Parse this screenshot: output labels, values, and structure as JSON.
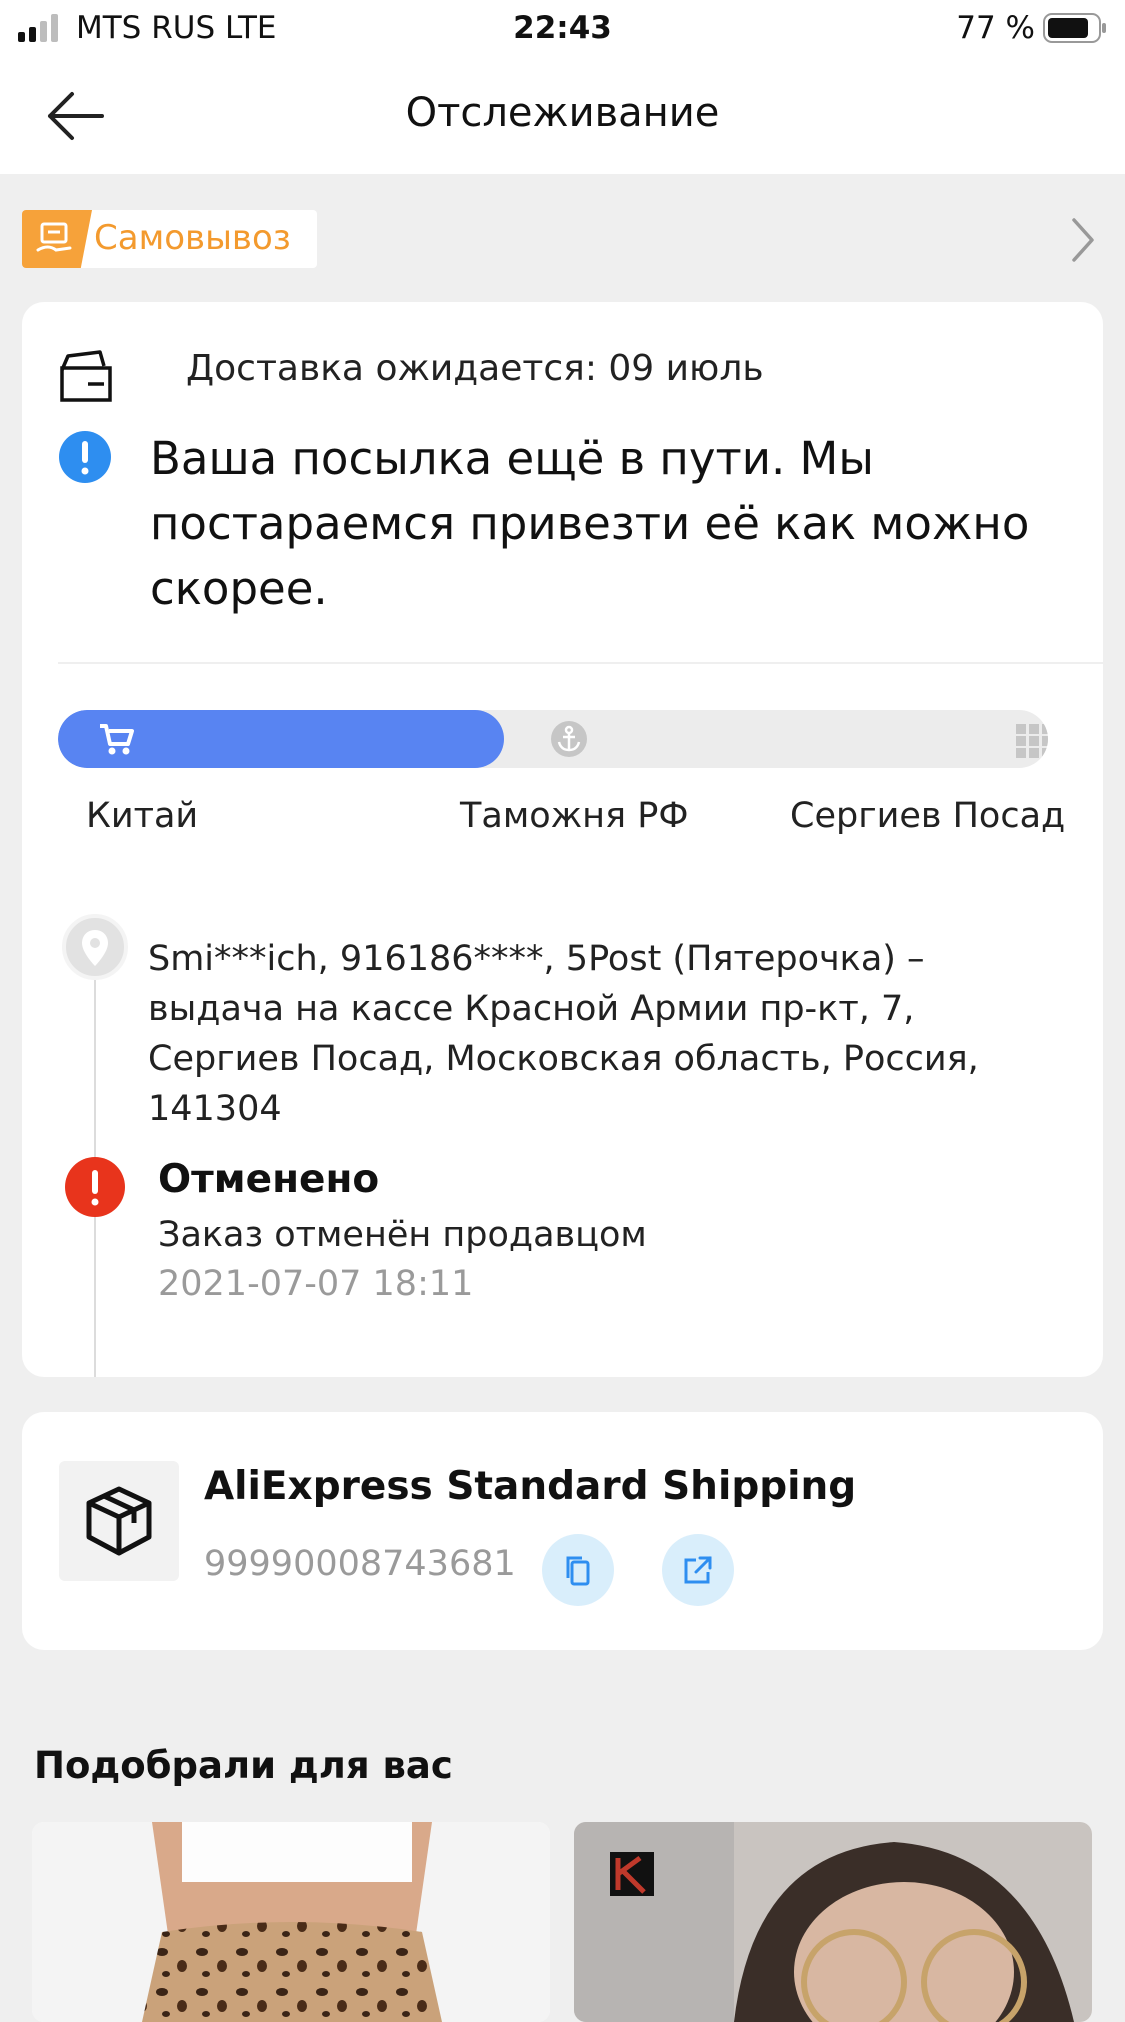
{
  "status_bar": {
    "carrier": "MTS RUS   LTE",
    "time": "22:43",
    "battery": "77 %"
  },
  "header": {
    "title": "Отслеживание"
  },
  "pickup": {
    "label": "Самовывоз",
    "accent_color": "#f39a2e"
  },
  "tracking": {
    "delivery_expected": "Доставка ожидается: 09 июль",
    "status_message": "Ваша посылка ещё в пути. Мы постараемся привезти её как можно скорее.",
    "progress": {
      "fill_fraction": 0.45,
      "color": "#5884f2",
      "stages": [
        "Китай",
        "Таможня РФ",
        "Сергиев Посад"
      ]
    },
    "address": "Smi***ich,  916186****,  5Post (Пятерочка) – выдача на кассе Красной Армии пр-кт, 7,  Сергиев Посад,  Московская область,  Россия,  141304",
    "event": {
      "title": "Отменено",
      "description": "Заказ отменён продавцом",
      "time": "2021-07-07 18:11",
      "color": "#e8341c"
    }
  },
  "shipping": {
    "service": "AliExpress Standard Shipping",
    "tracking_number": "99990008743681"
  },
  "recommendations": {
    "title": "Подобрали для вас"
  }
}
